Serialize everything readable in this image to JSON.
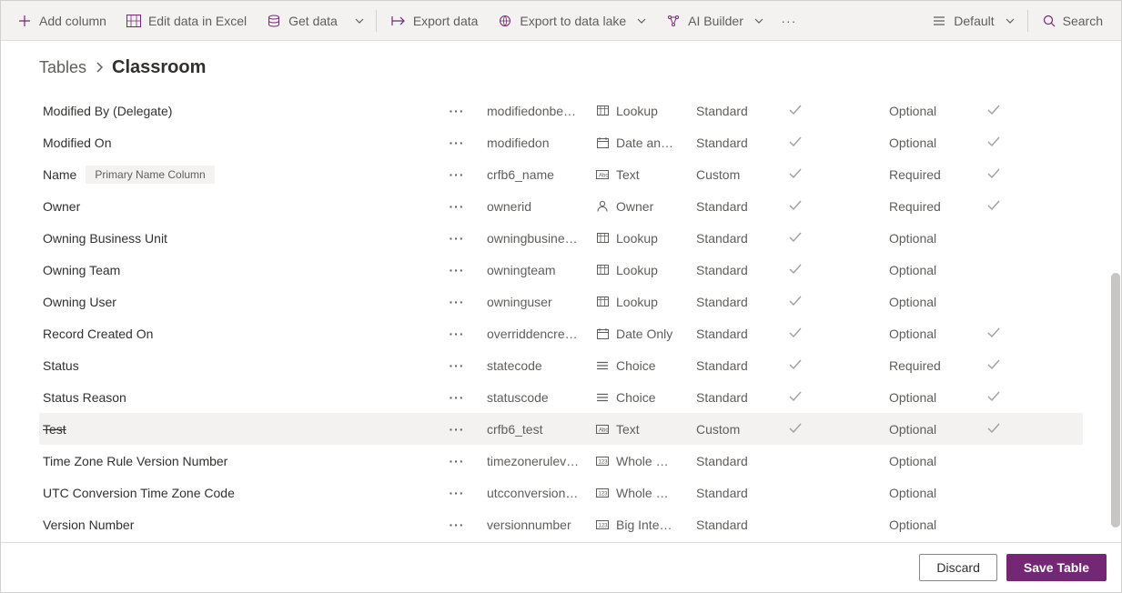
{
  "toolbar": {
    "add_column": "Add column",
    "edit_excel": "Edit data in Excel",
    "get_data": "Get data",
    "export_data": "Export data",
    "export_lake": "Export to data lake",
    "ai_builder": "AI Builder",
    "default_view": "Default",
    "search": "Search"
  },
  "breadcrumb": {
    "parent": "Tables",
    "current": "Classroom"
  },
  "badge_primary": "Primary Name Column",
  "rows": [
    {
      "name": "Modified By (Delegate)",
      "schema": "modifiedonbe…",
      "type": "Lookup",
      "icon": "lookup",
      "ctype": "Standard",
      "c1": true,
      "req": "Optional",
      "c2": true
    },
    {
      "name": "Modified On",
      "schema": "modifiedon",
      "type": "Date an…",
      "icon": "date",
      "ctype": "Standard",
      "c1": true,
      "req": "Optional",
      "c2": true
    },
    {
      "name": "Name",
      "badge": true,
      "schema": "crfb6_name",
      "type": "Text",
      "icon": "text",
      "ctype": "Custom",
      "c1": true,
      "req": "Required",
      "c2": true
    },
    {
      "name": "Owner",
      "schema": "ownerid",
      "type": "Owner",
      "icon": "owner",
      "ctype": "Standard",
      "c1": true,
      "req": "Required",
      "c2": true
    },
    {
      "name": "Owning Business Unit",
      "schema": "owningbusine…",
      "type": "Lookup",
      "icon": "lookup",
      "ctype": "Standard",
      "c1": true,
      "req": "Optional",
      "c2": false
    },
    {
      "name": "Owning Team",
      "schema": "owningteam",
      "type": "Lookup",
      "icon": "lookup",
      "ctype": "Standard",
      "c1": true,
      "req": "Optional",
      "c2": false
    },
    {
      "name": "Owning User",
      "schema": "owninguser",
      "type": "Lookup",
      "icon": "lookup",
      "ctype": "Standard",
      "c1": true,
      "req": "Optional",
      "c2": false
    },
    {
      "name": "Record Created On",
      "schema": "overriddencre…",
      "type": "Date Only",
      "icon": "date",
      "ctype": "Standard",
      "c1": true,
      "req": "Optional",
      "c2": true
    },
    {
      "name": "Status",
      "schema": "statecode",
      "type": "Choice",
      "icon": "choice",
      "ctype": "Standard",
      "c1": true,
      "req": "Required",
      "c2": true
    },
    {
      "name": "Status Reason",
      "schema": "statuscode",
      "type": "Choice",
      "icon": "choice",
      "ctype": "Standard",
      "c1": true,
      "req": "Optional",
      "c2": true
    },
    {
      "name": "Test",
      "strike": true,
      "schema": "crfb6_test",
      "type": "Text",
      "icon": "text",
      "ctype": "Custom",
      "c1": true,
      "req": "Optional",
      "c2": true,
      "highlight": true
    },
    {
      "name": "Time Zone Rule Version Number",
      "schema": "timezonerulev…",
      "type": "Whole …",
      "icon": "number",
      "ctype": "Standard",
      "c1": false,
      "req": "Optional",
      "c2": false
    },
    {
      "name": "UTC Conversion Time Zone Code",
      "schema": "utcconversion…",
      "type": "Whole …",
      "icon": "number",
      "ctype": "Standard",
      "c1": false,
      "req": "Optional",
      "c2": false
    },
    {
      "name": "Version Number",
      "schema": "versionnumber",
      "type": "Big Inte…",
      "icon": "number",
      "ctype": "Standard",
      "c1": false,
      "req": "Optional",
      "c2": false
    }
  ],
  "footer": {
    "discard": "Discard",
    "save": "Save Table"
  }
}
